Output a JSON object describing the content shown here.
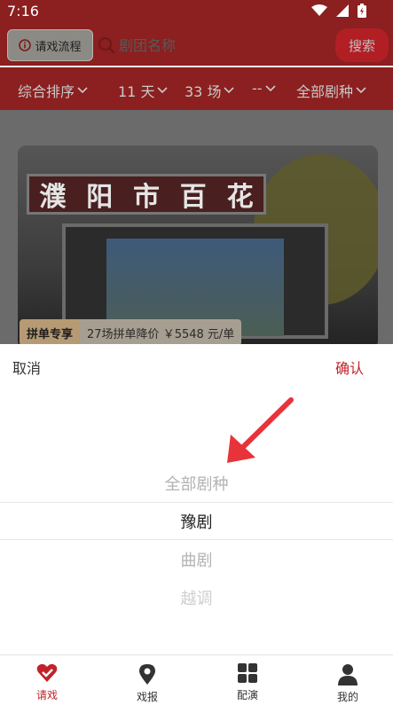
{
  "status_bar": {
    "time": "7:16"
  },
  "header": {
    "flow_button": "请戏流程",
    "search_placeholder": "剧团名称",
    "search_button": "搜索"
  },
  "filters": [
    {
      "label": "综合排序"
    },
    {
      "label": "11 天"
    },
    {
      "label": "33 场"
    },
    {
      "label": "--"
    },
    {
      "label": "全部剧种"
    }
  ],
  "card": {
    "banner_chars": [
      "濮",
      "阳",
      "市",
      "百",
      "花"
    ],
    "promo_label": "拼单专享",
    "promo_text": "27场拼单降价 ￥5548 元/单"
  },
  "picker": {
    "cancel": "取消",
    "confirm": "确认",
    "options": [
      "全部剧种",
      "豫剧",
      "曲剧",
      "越调"
    ],
    "selected": "豫剧"
  },
  "bottom_nav": [
    {
      "label": "请戏",
      "icon": "heart-check-icon",
      "active": true
    },
    {
      "label": "戏报",
      "icon": "location-pin-icon",
      "active": false
    },
    {
      "label": "配演",
      "icon": "grid-icon",
      "active": false
    },
    {
      "label": "我的",
      "icon": "person-icon",
      "active": false
    }
  ],
  "colors": {
    "brand_red": "#c0242a",
    "header_dim": "#8c1f1f"
  }
}
